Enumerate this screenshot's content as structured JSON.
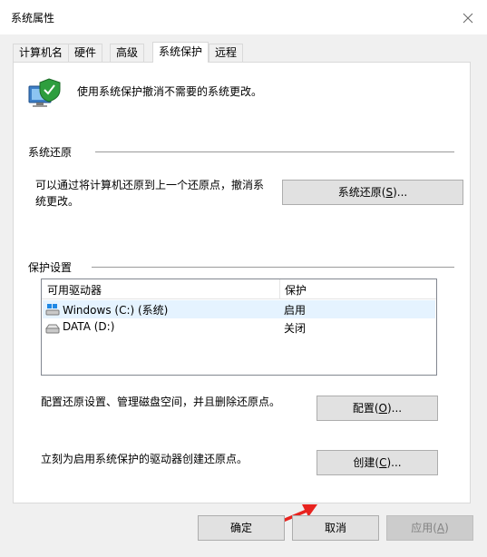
{
  "window": {
    "title": "系统属性"
  },
  "tabs": [
    {
      "label": "计算机名",
      "active": false
    },
    {
      "label": "硬件",
      "active": false
    },
    {
      "label": "高级",
      "active": false
    },
    {
      "label": "系统保护",
      "active": true
    },
    {
      "label": "远程",
      "active": false
    }
  ],
  "intro_text": "使用系统保护撤消不需要的系统更改。",
  "system_restore": {
    "group_title": "系统还原",
    "description_line1": "可以通过将计算机还原到上一个还原点，撤消系",
    "description_line2": "统更改。",
    "button_label": "系统还原(",
    "button_accel": "S",
    "button_suffix": ")..."
  },
  "protection_settings": {
    "group_title": "保护设置",
    "columns": [
      "可用驱动器",
      "保护"
    ],
    "drives": [
      {
        "name": "Windows (C:) (系统)",
        "protection": "启用",
        "selected": true,
        "icon": "system-drive-icon"
      },
      {
        "name": "DATA (D:)",
        "protection": "关闭",
        "selected": false,
        "icon": "drive-icon"
      }
    ],
    "configure_text": "配置还原设置、管理磁盘空间，并且删除还原点。",
    "configure_button_label": "配置(",
    "configure_button_accel": "O",
    "configure_button_suffix": ")...",
    "create_text": "立刻为启用系统保护的驱动器创建还原点。",
    "create_button_label": "创建(",
    "create_button_accel": "C",
    "create_button_suffix": ")..."
  },
  "footer": {
    "ok_label": "确定",
    "cancel_label": "取消",
    "apply_label": "应用(",
    "apply_accel": "A",
    "apply_suffix": ")"
  },
  "annotation": {
    "arrow_color": "#e8231f"
  }
}
